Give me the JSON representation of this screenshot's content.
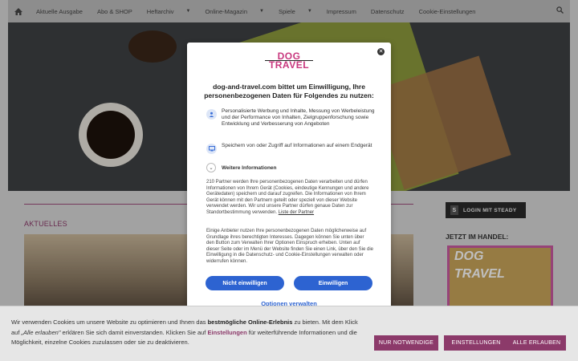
{
  "nav": {
    "items": [
      {
        "label": "Aktuelle Ausgabe"
      },
      {
        "label": "Abo & SHOP"
      },
      {
        "label": "Heftarchiv"
      },
      {
        "label": "Online-Magazin"
      },
      {
        "label": "Spiele"
      },
      {
        "label": "Impressum"
      },
      {
        "label": "Datenschutz"
      },
      {
        "label": "Cookie-Einstellungen"
      }
    ]
  },
  "content": {
    "section_title": "AKTUELLES",
    "steady_label": "LOGIN MIT STEADY",
    "steady_glyph": "S",
    "sidebar_title": "JETZT IM HANDEL:",
    "sidebar_mag_title_1": "DOG",
    "sidebar_mag_title_2": "TRAVEL"
  },
  "modal": {
    "logo_line1": "DOG",
    "logo_line2": "TRAVEL",
    "title": "dog-and-travel.com bittet um Einwilligung, Ihre personenbezogenen Daten für Folgendes zu nutzen:",
    "purpose1": "Personalisierte Werbung und Inhalte, Messung von Werbeleistung und der Performance von Inhalten, Zielgruppenforschung sowie Entwicklung und Verbesserung von Angeboten",
    "purpose2": "Speichern von oder Zugriff auf Informationen auf einem Endgerät",
    "more_info": "Weitere Informationen",
    "para1": "210 Partner werden Ihre personenbezogenen Daten verarbeiten und dürfen Informationen von Ihrem Gerät (Cookies, eindeutige Kennungen und andere Gerätedaten) speichern und darauf zugreifen. Die Informationen von Ihrem Gerät können mit den Partnern geteilt oder speziell von dieser Website verwendet werden. Wir und unsere Partner dürfen genaue Daten zur Standortbestimmung verwenden.",
    "para1_link": "Liste der Partner",
    "para2": "Einige Anbieter nutzen Ihre personenbezogenen Daten möglicherweise auf Grundlage ihres berechtigten Interesses. Dagegen können Sie unten über den Button zum Verwalten Ihrer Optionen Einspruch erheben. Unten auf dieser Seite oder im Menü der Website finden Sie einen Link, über den Sie die Einwilligung in die Datenschutz- und Cookie-Einstellungen verwalten oder widerrufen können.",
    "btn_decline": "Nicht einwilligen",
    "btn_accept": "Einwilligen",
    "btn_manage": "Optionen verwalten"
  },
  "cookiebar": {
    "text_1": "Wir verwenden Cookies um unsere Website zu optimieren und Ihnen das ",
    "text_bold": "bestmögliche Online-Erlebnis",
    "text_2": " zu bieten. Mit dem Klick auf ",
    "text_italic": "„Alle erlauben\"",
    "text_3": " erklären Sie sich damit einverstanden. Klicken Sie auf ",
    "text_link": "Einstellungen",
    "text_4": " für weiterführende Informationen und die Möglichkeit, einzelne Cookies zuzulassen oder sie zu deaktivieren.",
    "btn_necessary": "NUR NOTWENDIGE",
    "btn_settings": "EINSTELLUNGEN",
    "btn_all": "ALLE ERLAUBEN"
  },
  "colors": {
    "accent": "#8c3a6a",
    "logo": "#c8377e",
    "button_blue": "#2d63d1"
  }
}
